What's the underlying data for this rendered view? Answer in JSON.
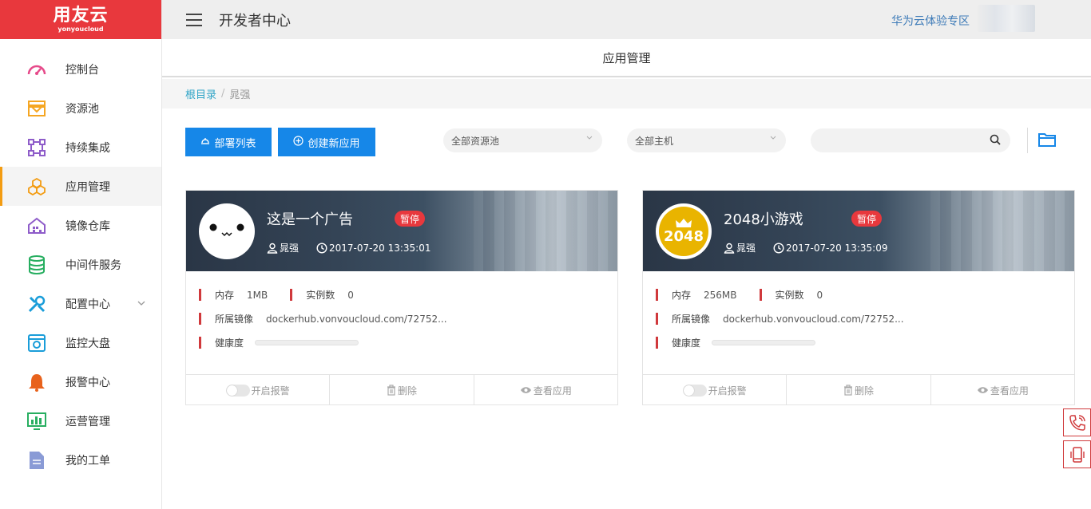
{
  "brand": {
    "name": "用友云",
    "sub": "yonyoucloud",
    "color": "#e8383d"
  },
  "sidebar": {
    "items": [
      {
        "label": "控制台",
        "icon": "dashboard-icon"
      },
      {
        "label": "资源池",
        "icon": "resource-pool-icon"
      },
      {
        "label": "持续集成",
        "icon": "integration-icon"
      },
      {
        "label": "应用管理",
        "icon": "app-management-icon",
        "active": true
      },
      {
        "label": "镜像仓库",
        "icon": "image-repo-icon"
      },
      {
        "label": "中间件服务",
        "icon": "database-icon"
      },
      {
        "label": "配置中心",
        "icon": "tools-icon",
        "expandable": true
      },
      {
        "label": "监控大盘",
        "icon": "monitor-icon"
      },
      {
        "label": "报警中心",
        "icon": "bell-icon"
      },
      {
        "label": "运营管理",
        "icon": "chart-icon"
      },
      {
        "label": "我的工单",
        "icon": "document-icon"
      }
    ]
  },
  "topbar": {
    "title": "开发者中心",
    "link": "华为云体验专区"
  },
  "page": {
    "title": "应用管理"
  },
  "breadcrumb": {
    "root": "根目录",
    "separator": "/",
    "current": "晁强"
  },
  "toolbar": {
    "deploy_list": "部署列表",
    "create_app": "创建新应用",
    "pool_select": "全部资源池",
    "host_select": "全部主机",
    "search_placeholder": ""
  },
  "cards": [
    {
      "name": "这是一个广告",
      "status": "暂停",
      "owner": "晁强",
      "time": "2017-07-20 13:35:01",
      "memory_label": "内存",
      "memory": "1MB",
      "instances_label": "实例数",
      "instances": "0",
      "image_label": "所属镜像",
      "image": "dockerhub.vonvoucloud.com/72752...",
      "health_label": "健康度",
      "alarm": "开启报警",
      "delete": "删除",
      "view": "查看应用"
    },
    {
      "name": "2048小游戏",
      "status": "暂停",
      "owner": "晁强",
      "time": "2017-07-20 13:35:09",
      "logo_text": "2048",
      "memory_label": "内存",
      "memory": "256MB",
      "instances_label": "实例数",
      "instances": "0",
      "image_label": "所属镜像",
      "image": "dockerhub.vonvoucloud.com/72752...",
      "health_label": "健康度",
      "alarm": "开启报警",
      "delete": "删除",
      "view": "查看应用"
    }
  ]
}
